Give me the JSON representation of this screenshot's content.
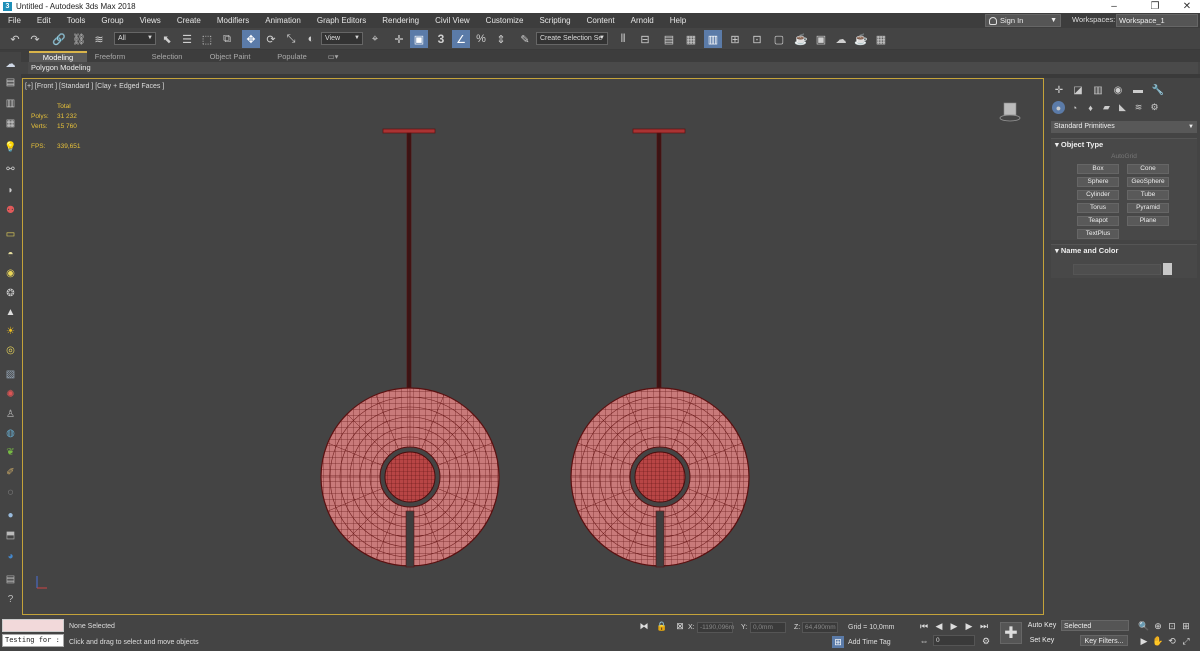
{
  "title": {
    "text": "Untitled - Autodesk 3ds Max 2018"
  },
  "menu": [
    "File",
    "Edit",
    "Tools",
    "Group",
    "Views",
    "Create",
    "Modifiers",
    "Animation",
    "Graph Editors",
    "Rendering",
    "Civil View",
    "Customize",
    "Scripting",
    "Content",
    "Arnold",
    "Help"
  ],
  "signin": {
    "label": "Sign In"
  },
  "workspaces": {
    "label": "Workspaces:",
    "value": "Workspace_1"
  },
  "toolbar": {
    "filter_value": "All",
    "refcoord_value": "View",
    "selset_placeholder": "Create Selection Se"
  },
  "ribbon": {
    "tabs": [
      "Modeling",
      "Freeform",
      "Selection",
      "Object Paint",
      "Populate"
    ],
    "active_tab": "Modeling",
    "panel_label": "Polygon Modeling"
  },
  "viewport": {
    "label": "[+] [Front ] [Standard ] [Clay + Edged Faces ]",
    "stats": {
      "total_label": "Total",
      "polys_label": "Polys:",
      "polys_value": "31 232",
      "verts_label": "Verts:",
      "verts_value": "15 760",
      "fps_label": "FPS:",
      "fps_value": "339,651"
    }
  },
  "command_panel": {
    "dropdown": "Standard Primitives",
    "object_type_header": "Object Type",
    "autogrid": "AutoGrid",
    "buttons": [
      "Box",
      "Cone",
      "Sphere",
      "GeoSphere",
      "Cylinder",
      "Tube",
      "Torus",
      "Pyramid",
      "Teapot",
      "Plane",
      "TextPlus"
    ],
    "name_color_header": "Name and Color"
  },
  "status": {
    "maxscript_input": "Testing for :",
    "selection_text": "None Selected",
    "prompt_text": "Click and drag to select and move objects",
    "x_label": "X:",
    "x_value": "-1190,096m",
    "y_label": "Y:",
    "y_value": "0,0mm",
    "z_label": "Z:",
    "z_value": "64,490mm",
    "grid_text": "Grid = 10,0mm",
    "add_time_tag": "Add Time Tag",
    "frame_value": "0",
    "autokey": "Auto Key",
    "setkey": "Set Key",
    "selected_value": "Selected",
    "key_filters": "Key Filters..."
  },
  "colors": {
    "accent": "#5b7ba8",
    "object_wire": "#a23a3a",
    "object_fill": "#c97676",
    "viewport_border": "#c4a33a"
  }
}
